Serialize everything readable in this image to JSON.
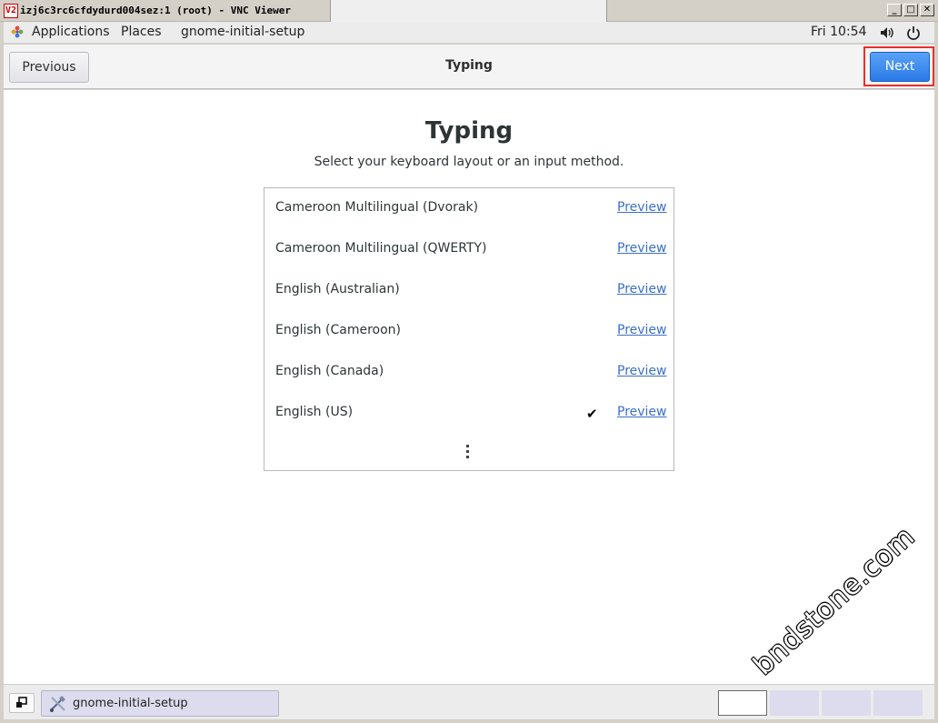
{
  "vnc_window": {
    "logo_text": "V2",
    "title": "izj6c3rc6cfdydurd004sez:1 (root) - VNC Viewer",
    "buttons": {
      "minimize": "_",
      "maximize": "□",
      "close": "✕"
    }
  },
  "topbar": {
    "menu_items": [
      "Applications",
      "Places",
      "gnome-initial-setup"
    ],
    "clock": "Fri 10:54"
  },
  "headerbar": {
    "previous_label": "Previous",
    "title": "Typing",
    "next_label": "Next",
    "next_highlighted": true,
    "highlight_color": "#e8302a",
    "accent_color": "#2a7ae8"
  },
  "main": {
    "title": "Typing",
    "subtitle": "Select your keyboard layout or an input method.",
    "layouts": [
      {
        "name": "Cameroon Multilingual (Dvorak)",
        "selected": false,
        "preview_label": "Preview"
      },
      {
        "name": "Cameroon Multilingual (QWERTY)",
        "selected": false,
        "preview_label": "Preview"
      },
      {
        "name": "English (Australian)",
        "selected": false,
        "preview_label": "Preview"
      },
      {
        "name": "English (Cameroon)",
        "selected": false,
        "preview_label": "Preview"
      },
      {
        "name": "English (Canada)",
        "selected": false,
        "preview_label": "Preview"
      },
      {
        "name": "English (US)",
        "selected": true,
        "preview_label": "Preview"
      }
    ],
    "check_glyph": "✔",
    "more_icon": "vertical-ellipsis-icon"
  },
  "watermark": "bndstone.com",
  "taskbar": {
    "task_label": "gnome-initial-setup",
    "workspaces": [
      {
        "active": true
      },
      {
        "active": false
      },
      {
        "active": false
      },
      {
        "active": false
      }
    ]
  }
}
